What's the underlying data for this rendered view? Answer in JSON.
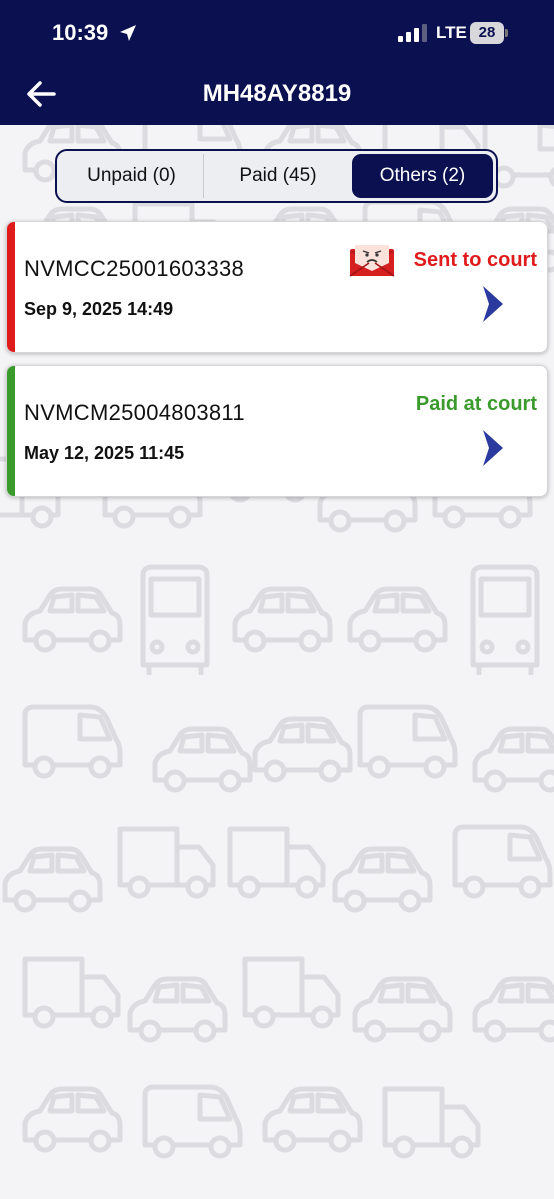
{
  "status_bar": {
    "time": "10:39",
    "network": "LTE",
    "battery": "28"
  },
  "header": {
    "title": "MH48AY8819"
  },
  "tabs": [
    {
      "label": "Unpaid (0)",
      "selected": false
    },
    {
      "label": "Paid (45)",
      "selected": false
    },
    {
      "label": "Others (2)",
      "selected": true
    }
  ],
  "challans": [
    {
      "id": "NVMCC25001603338",
      "date": "Sep 9, 2025 14:49",
      "status": "Sent to court",
      "status_color": "#e01b1b",
      "accent_color": "#e01b1b",
      "icon": "angry-mail-icon"
    },
    {
      "id": "NVMCM25004803811",
      "date": "May 12, 2025 11:45",
      "status": "Paid at court",
      "status_color": "#3a9a2c",
      "accent_color": "#3a9a2c",
      "icon": ""
    }
  ],
  "colors": {
    "header_bg": "#0b1150",
    "chevron": "#2b3a9e"
  }
}
